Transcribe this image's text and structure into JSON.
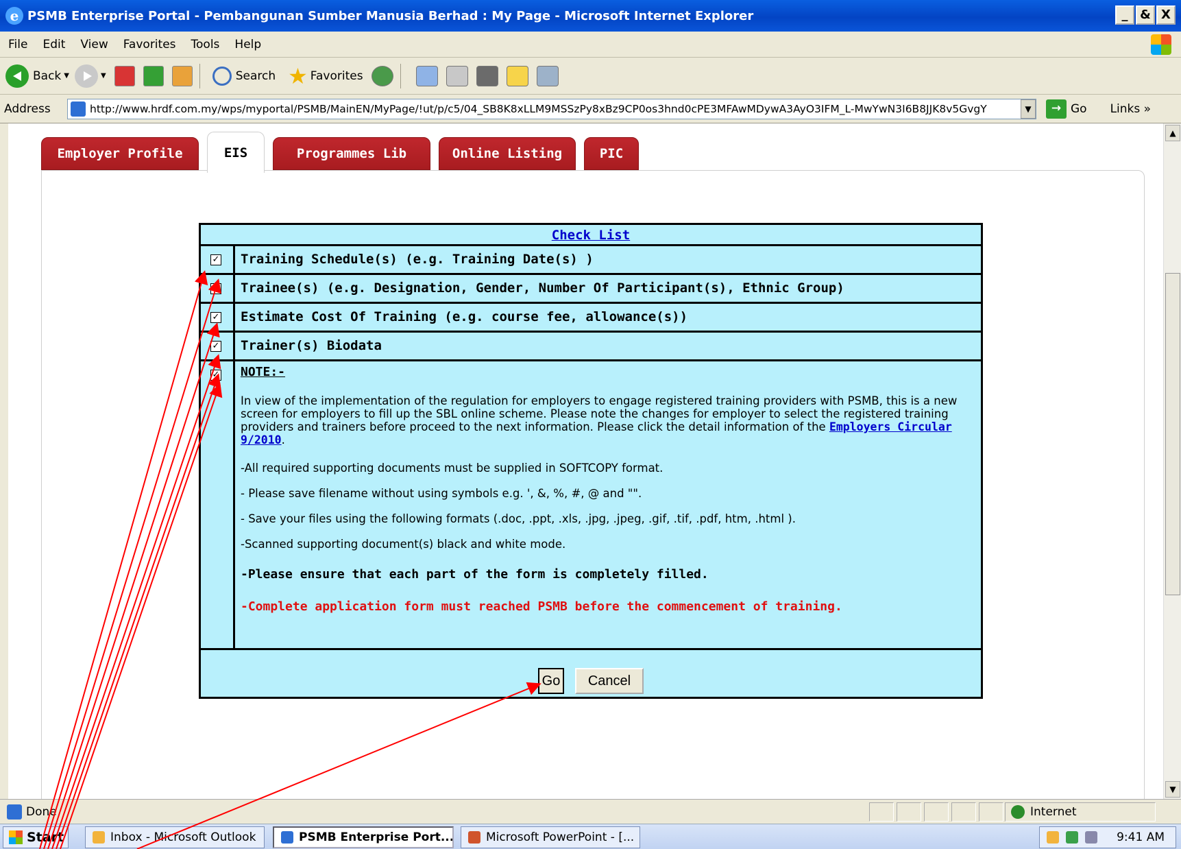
{
  "window": {
    "title": "PSMB Enterprise Portal - Pembangunan Sumber Manusia Berhad : My Page - Microsoft Internet Explorer",
    "controls": [
      "_",
      "&",
      "X"
    ]
  },
  "menu": [
    "File",
    "Edit",
    "View",
    "Favorites",
    "Tools",
    "Help"
  ],
  "toolbar": {
    "back_label": "Back",
    "search_label": "Search",
    "favorites_label": "Favorites"
  },
  "address": {
    "label": "Address",
    "url": "http://www.hrdf.com.my/wps/myportal/PSMB/MainEN/MyPage/!ut/p/c5/04_SB8K8xLLM9MSSzPy8xBz9CP0os3hnd0cPE3MFAwMDywA3AyO3IFM_L-MwYwN3I6B8JJK8v5GvgY",
    "go_label": "Go",
    "links_label": "Links"
  },
  "tabs": [
    {
      "label": "Employer Profile",
      "active": false
    },
    {
      "label": "EIS",
      "active": true
    },
    {
      "label": "Programmes Lib",
      "active": false
    },
    {
      "label": "Online Listing",
      "active": false
    },
    {
      "label": "PIC",
      "active": false
    }
  ],
  "checklist": {
    "header": "Check List",
    "items": [
      {
        "label": "Training Schedule(s) (e.g. Training Date(s) )",
        "checked": true
      },
      {
        "label": "Trainee(s) (e.g. Designation, Gender, Number Of Participant(s), Ethnic Group)",
        "checked": true
      },
      {
        "label": "Estimate Cost Of Training (e.g. course fee, allowance(s))",
        "checked": true
      },
      {
        "label": "Trainer(s) Biodata",
        "checked": true
      }
    ],
    "note": {
      "checked": true,
      "title": "NOTE:-",
      "intro": "In view of the implementation of the regulation for employers to engage registered training providers with PSMB, this is a new screen for employers to fill up the SBL online scheme. Please note the changes for employer to select the registered training providers and trainers before proceed to the next information. Please click the detail information of the ",
      "link": "Employers Circular 9/2010",
      "intro_end": ".",
      "points": [
        "-All required supporting documents must be supplied in SOFTCOPY format.",
        "- Please save filename without using symbols e.g. ', &, %, #, @ and \"\".",
        "- Save your files using the following formats (.doc, .ppt, .xls, .jpg, .jpeg, .gif, .tif, .pdf, htm, .html ).",
        "-Scanned supporting document(s) black and white mode."
      ],
      "bold_point": "-Please ensure that each part of the form is completely filled.",
      "red_point": "-Complete application form must reached PSMB before the commencement of training."
    },
    "buttons": {
      "go": "Go",
      "cancel": "Cancel"
    }
  },
  "statusbar": {
    "status": "Done",
    "zone": "Internet"
  },
  "taskbar": {
    "start": "Start",
    "items": [
      {
        "label": "Inbox - Microsoft Outlook",
        "active": false
      },
      {
        "label": "PSMB Enterprise Port...",
        "active": true
      },
      {
        "label": "Microsoft PowerPoint - [...",
        "active": false
      }
    ],
    "clock": "9:41 AM"
  },
  "colors": {
    "tab_red": "#b32025",
    "checklist_bg": "#b8f0fc",
    "link_blue": "#0000cc",
    "warning_red": "#e01010",
    "annotation_red": "#ff0000"
  }
}
